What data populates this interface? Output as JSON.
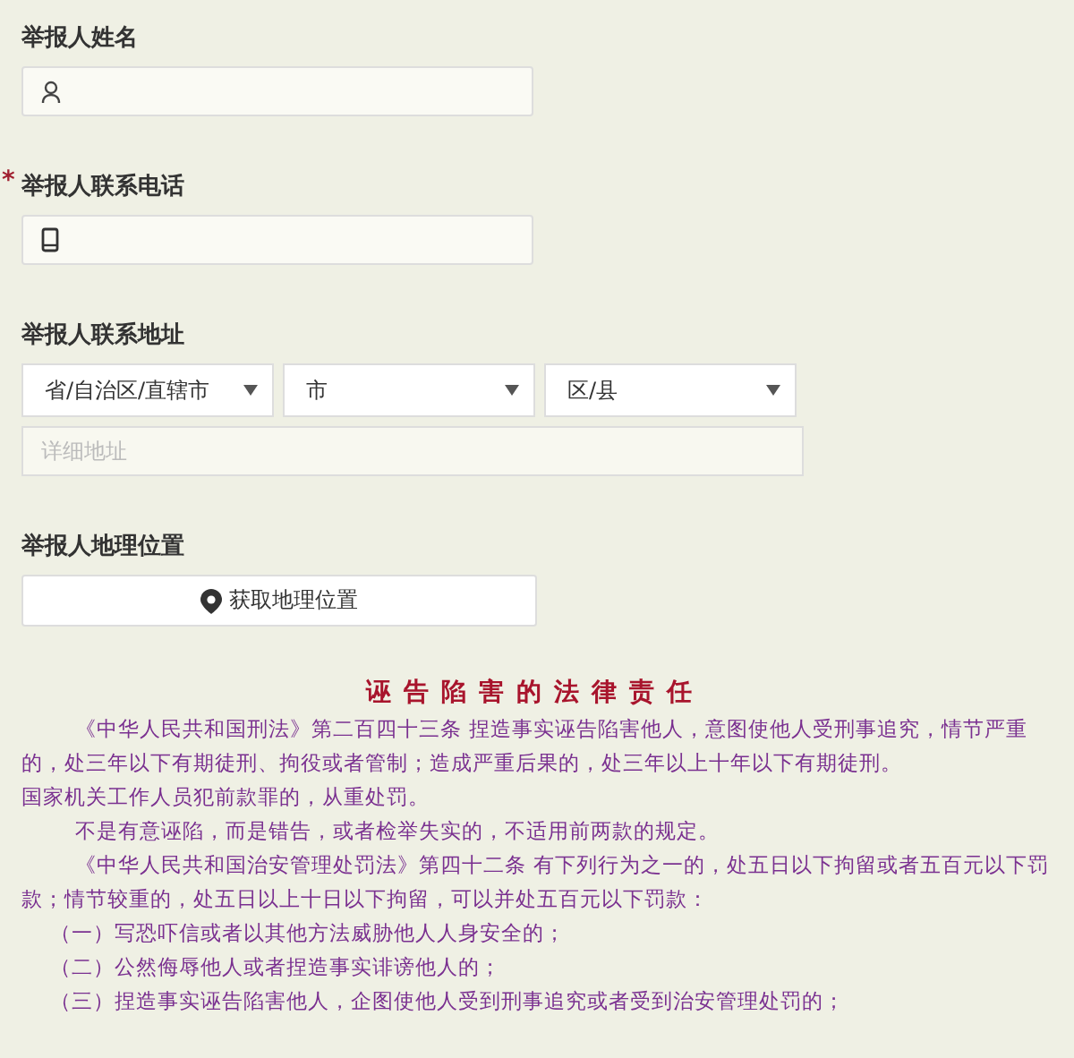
{
  "fields": [
    {
      "kind": "name",
      "label": "举报人姓名"
    },
    {
      "kind": "phone",
      "label": "举报人联系电话",
      "required_mark": "*"
    },
    {
      "kind": "address",
      "label": "举报人联系地址",
      "selects": [
        "省/自治区/直辖市",
        "市",
        "区/县"
      ],
      "placeholder": "详细地址"
    },
    {
      "kind": "location",
      "label": "举报人地理位置",
      "button": "获取地理位置"
    }
  ],
  "notice": {
    "title": "诬告陷害的法律责任",
    "paragraphs": [
      {
        "kind": "indent",
        "text": "《中华人民共和国刑法》第二百四十三条 捏造事实诬告陷害他人，意图使他人受刑事追究，情节严重的，处三年以下有期徒刑、拘役或者管制；造成严重后果的，处三年以上十年以下有期徒刑。"
      },
      {
        "kind": "plain",
        "text": "国家机关工作人员犯前款罪的，从重处罚。"
      },
      {
        "kind": "indent",
        "text": "不是有意诬陷，而是错告，或者检举失实的，不适用前两款的规定。"
      },
      {
        "kind": "indent",
        "text": "《中华人民共和国治安管理处罚法》第四十二条 有下列行为之一的，处五日以下拘留或者五百元以下罚款；情节较重的，处五日以上十日以下拘留，可以并处五百元以下罚款："
      },
      {
        "kind": "item",
        "text": "（一）写恐吓信或者以其他方法威胁他人人身安全的；"
      },
      {
        "kind": "item",
        "text": "（二）公然侮辱他人或者捏造事实诽谤他人的；"
      },
      {
        "kind": "item",
        "text": "（三）捏造事实诬告陷害他人，企图使他人受到刑事追究或者受到治安管理处罚的；"
      }
    ]
  }
}
